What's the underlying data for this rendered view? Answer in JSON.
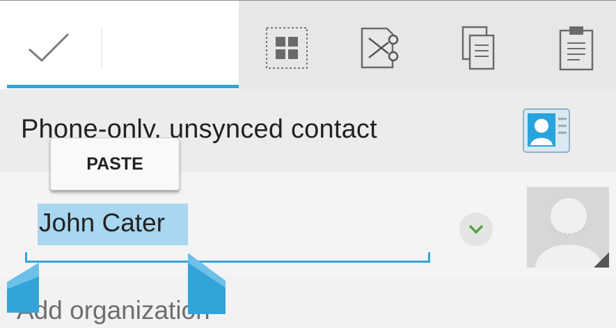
{
  "action_bar": {
    "done_icon": "checkmark-icon",
    "buttons": [
      {
        "name": "select-all-icon",
        "label": "Select all"
      },
      {
        "name": "cut-icon",
        "label": "Cut"
      },
      {
        "name": "copy-icon",
        "label": "Copy"
      },
      {
        "name": "paste-icon",
        "label": "Paste"
      }
    ],
    "accent_color": "#33a4d8"
  },
  "account": {
    "label": "Phone-only, unsynced contact",
    "icon": "contact-card-icon"
  },
  "popup": {
    "paste_label": "PASTE"
  },
  "name_field": {
    "value": "John Cater",
    "expand_icon": "chevron-down-icon",
    "selection_color": "#a9d6f0"
  },
  "avatar": {
    "icon": "default-avatar-icon"
  },
  "organization": {
    "placeholder": "Add organization"
  }
}
